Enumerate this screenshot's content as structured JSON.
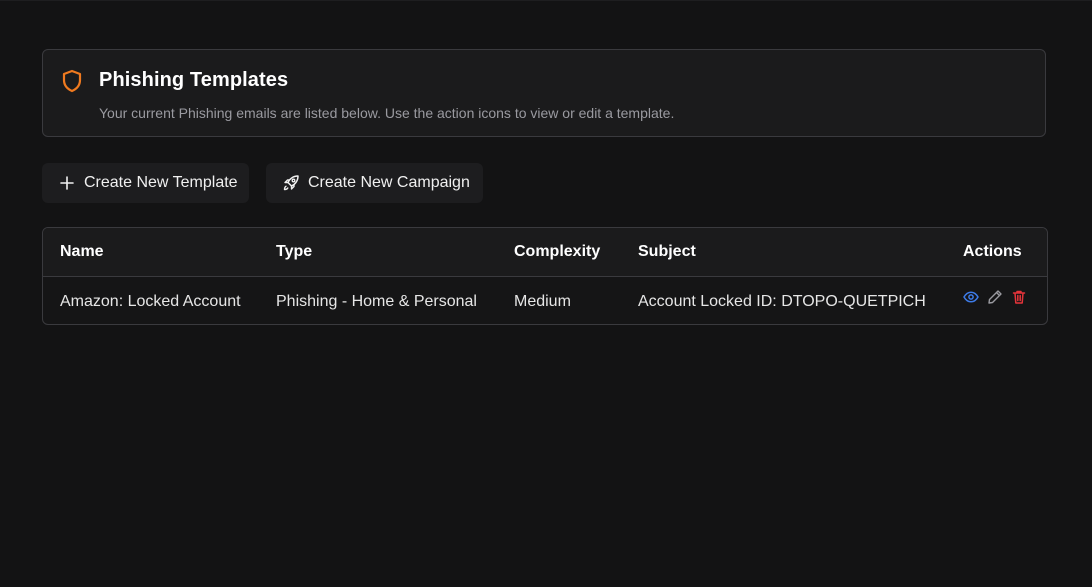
{
  "header": {
    "title": "Phishing Templates",
    "subtitle": "Your current Phishing emails are listed below. Use the action icons to view or edit a template.",
    "icon": "shield-icon",
    "icon_color": "#f07a1f"
  },
  "toolbar": {
    "create_template_label": "Create New Template",
    "create_template_icon": "plus-icon",
    "create_campaign_label": "Create New Campaign",
    "create_campaign_icon": "rocket-icon"
  },
  "table": {
    "columns": [
      "Name",
      "Type",
      "Complexity",
      "Subject",
      "Actions"
    ],
    "rows": [
      {
        "name": "Amazon: Locked Account",
        "type": "Phishing - Home & Personal",
        "complexity": "Medium",
        "subject": "Account Locked ID: DTOPO-QUETPICH",
        "actions": [
          {
            "icon": "eye-icon",
            "color": "#3d7be8"
          },
          {
            "icon": "pencil-icon",
            "color": "#9a9aa0"
          },
          {
            "icon": "trash-icon",
            "color": "#e5343a"
          }
        ]
      }
    ]
  }
}
